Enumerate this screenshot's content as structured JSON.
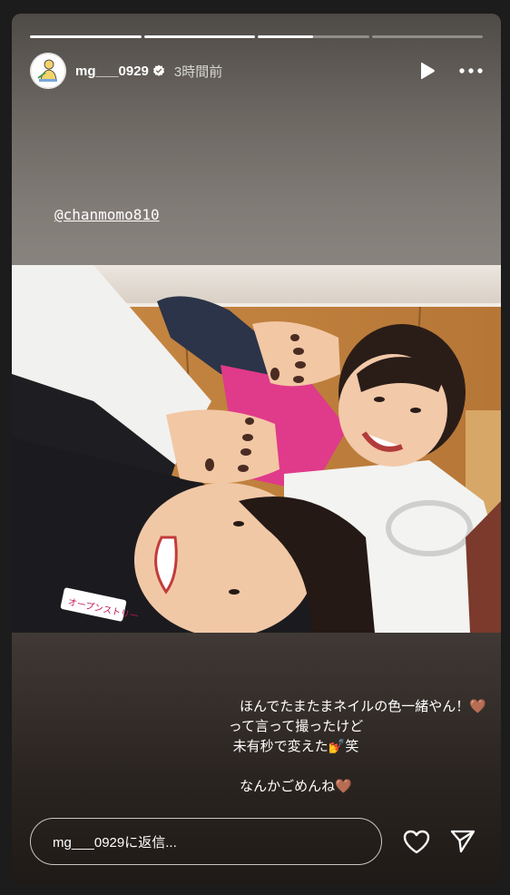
{
  "story": {
    "progress": [
      1,
      1,
      0.5,
      0
    ],
    "user": {
      "username": "mg___0929",
      "time": "3時間前",
      "verified": true
    },
    "mention": "@chanmomo810",
    "caption": {
      "line1": "ほんでたまたまネイルの色一緒やん！",
      "line1_emoji": "🤎",
      "line2": "って言って撮ったけど",
      "line3": "未有秒で変えた",
      "line3_emoji": "💅",
      "line3_suffix": "笑",
      "line4": "なんかごめんね",
      "line4_emoji": "🤎"
    },
    "reply_placeholder": "mg___0929に返信...",
    "colors": {
      "progress_fill": "#ffffff",
      "verified_badge": "#ffffff"
    },
    "icons": [
      "play-icon",
      "more-icon",
      "heart-icon",
      "send-icon",
      "verified-icon"
    ]
  }
}
